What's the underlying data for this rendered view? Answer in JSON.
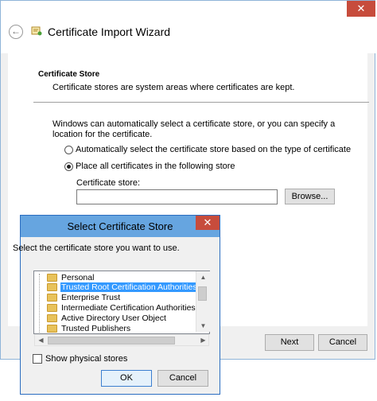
{
  "wizard": {
    "title": "Certificate Import Wizard",
    "close_glyph": "✕",
    "back_glyph": "←",
    "section_title": "Certificate Store",
    "section_desc": "Certificate stores are system areas where certificates are kept.",
    "auto_text": "Windows can automatically select a certificate store, or you can specify a location for the certificate.",
    "radio_auto_label": "Automatically select the certificate store based on the type of certificate",
    "radio_place_label": "Place all certificates in the following store",
    "store_label": "Certificate store:",
    "store_value": "",
    "browse_label": "Browse...",
    "next_label": "Next",
    "cancel_label": "Cancel"
  },
  "dialog": {
    "title": "Select Certificate Store",
    "close_glyph": "✕",
    "prompt": "Select the certificate store you want to use.",
    "tree_items": [
      {
        "label": "Personal",
        "selected": false
      },
      {
        "label": "Trusted Root Certification Authorities",
        "selected": true
      },
      {
        "label": "Enterprise Trust",
        "selected": false
      },
      {
        "label": "Intermediate Certification Authorities",
        "selected": false
      },
      {
        "label": "Active Directory User Object",
        "selected": false
      },
      {
        "label": "Trusted Publishers",
        "selected": false
      }
    ],
    "show_physical_label": "Show physical stores",
    "show_physical_checked": false,
    "ok_label": "OK",
    "cancel_label": "Cancel"
  },
  "icons": {
    "wizard_icon": "certificate-icon",
    "folder_icon": "folder-icon"
  }
}
